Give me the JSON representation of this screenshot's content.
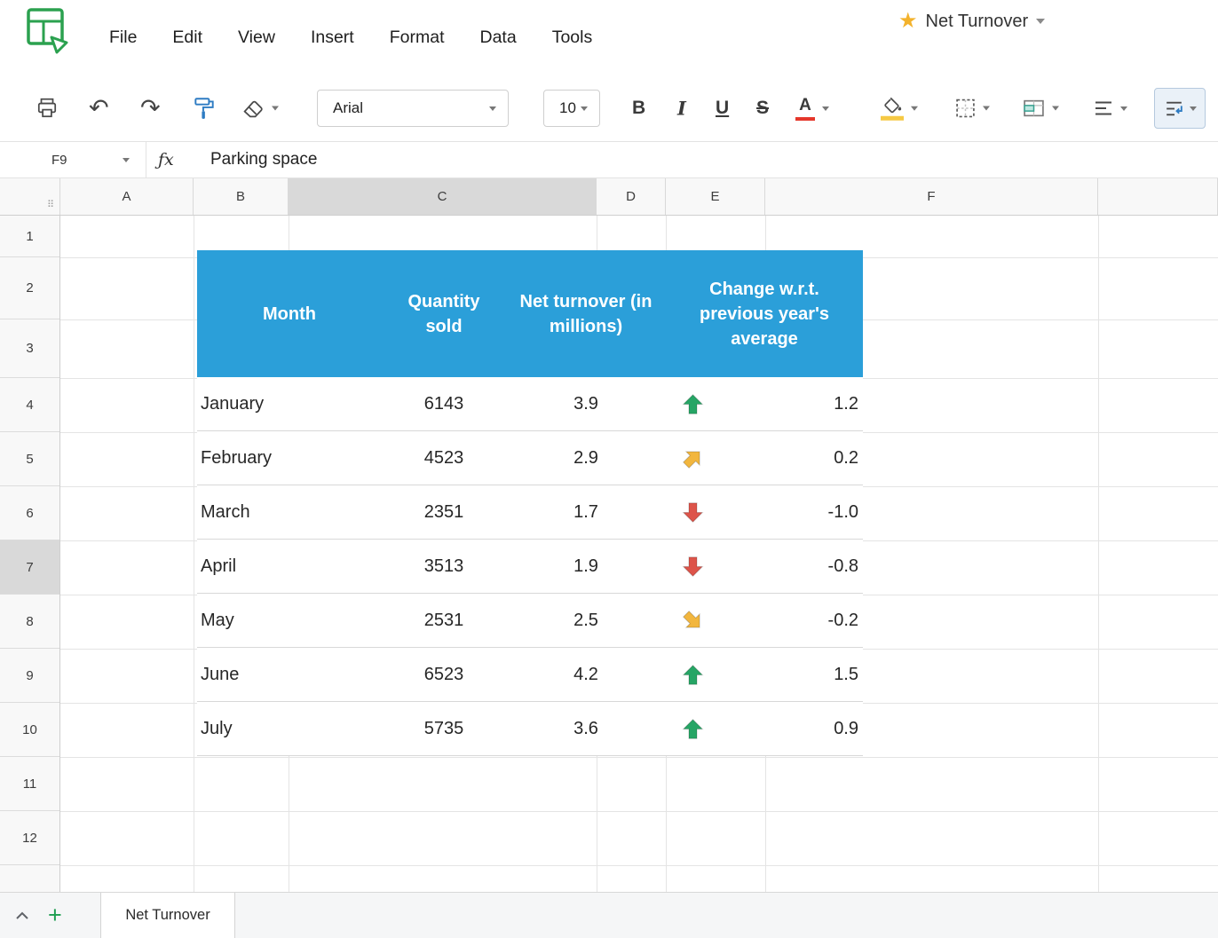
{
  "theme": {
    "table-header-bg": "#2b9fd9",
    "trend-up": "#26a565",
    "trend-down": "#dd544a",
    "trend-flat": "#f2b63e",
    "accent-green": "#1d9e50",
    "font-color-red": "#e5372b",
    "fill-yellow": "#f6c944"
  },
  "titlebar": {
    "title": "Net Turnover"
  },
  "menubar": {
    "items": [
      "File",
      "Edit",
      "View",
      "Insert",
      "Format",
      "Data",
      "Tools"
    ]
  },
  "toolbar": {
    "font_name": "Arial",
    "font_size": "10",
    "bold": "B",
    "italic": "I",
    "underline": "U",
    "strikethrough": "S",
    "font_color": "A"
  },
  "formula_bar": {
    "cell_ref": "F9",
    "fx": "ƒx",
    "value": "Parking space"
  },
  "grid": {
    "col_headers": [
      "A",
      "B",
      "C",
      "D",
      "E",
      "F"
    ],
    "row_headers": [
      "1",
      "2",
      "3",
      "4",
      "5",
      "6",
      "7",
      "8",
      "9",
      "10",
      "11",
      "12"
    ],
    "selected_column": "C",
    "selected_row": "7",
    "corner_dots": "⠿"
  },
  "table": {
    "headers": {
      "month": "Month",
      "qty": "Quantity sold",
      "turnover": "Net turnover (in millions)",
      "change": "Change w.r.t. previous year's average"
    },
    "rows": [
      {
        "month": "January",
        "qty": "6143",
        "turnover": "3.9",
        "trend": "up",
        "change": "1.2"
      },
      {
        "month": "February",
        "qty": "4523",
        "turnover": "2.9",
        "trend": "up-right",
        "change": "0.2"
      },
      {
        "month": "March",
        "qty": "2351",
        "turnover": "1.7",
        "trend": "down",
        "change": "-1.0"
      },
      {
        "month": "April",
        "qty": "3513",
        "turnover": "1.9",
        "trend": "down",
        "change": "-0.8"
      },
      {
        "month": "May",
        "qty": "2531",
        "turnover": "2.5",
        "trend": "down-right",
        "change": "-0.2"
      },
      {
        "month": "June",
        "qty": "6523",
        "turnover": "4.2",
        "trend": "up",
        "change": "1.5"
      },
      {
        "month": "July",
        "qty": "5735",
        "turnover": "3.6",
        "trend": "up",
        "change": "0.9"
      }
    ]
  },
  "tabbar": {
    "active_tab": "Net Turnover",
    "undo_glyph": "↶",
    "redo_glyph": "↷"
  }
}
